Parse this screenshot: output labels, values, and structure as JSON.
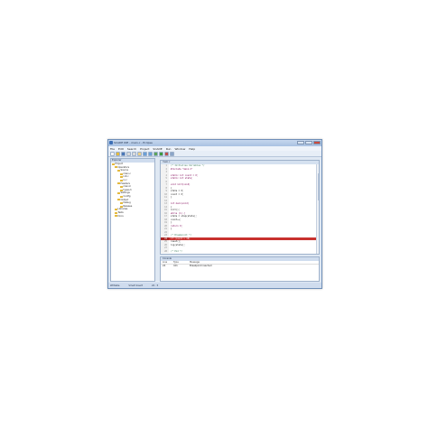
{
  "window": {
    "title": "SCADE IDE - main.c - Eclipse"
  },
  "menubar": [
    "File",
    "Edit",
    "Search",
    "Project",
    "SCADE",
    "Run",
    "Window",
    "Help"
  ],
  "toolbar": {
    "buttons": [
      {
        "icon": "new-file-icon",
        "color": "#f4f4f4"
      },
      {
        "icon": "open-folder-icon",
        "color": "#e4b93c"
      },
      {
        "icon": "save-icon",
        "color": "#4b78b8"
      },
      {
        "icon": "cut-icon",
        "color": "#d9d9d9"
      },
      {
        "icon": "copy-icon",
        "color": "#d9d9d9"
      },
      {
        "icon": "paste-icon",
        "color": "#e9d08a"
      },
      {
        "icon": "undo-icon",
        "color": "#6aa0d8"
      },
      {
        "icon": "redo-icon",
        "color": "#6aa0d8"
      },
      {
        "icon": "build-icon",
        "color": "#5ea55a"
      },
      {
        "icon": "run-icon",
        "color": "#3f9a3f"
      },
      {
        "icon": "debug-icon",
        "color": "#c0504d"
      },
      {
        "icon": "search-icon",
        "color": "#8ba6c9"
      }
    ]
  },
  "left_pane": {
    "caption": "Explorer",
    "tree": [
      "Project",
      "Operators",
      "Source",
      "main.c",
      "init.c",
      "io.c",
      "Headers",
      "main.h",
      "types.h",
      "Settings",
      "Config",
      "Output",
      "Debug",
      "Release",
      "Libraries",
      "Tests",
      "Docs"
    ]
  },
  "editor": {
    "tab": "main.c",
    "lines": [
      {
        "no": "1",
        "text": "/* Initialise Variables */"
      },
      {
        "no": "2",
        "text": "#include \"main.h\""
      },
      {
        "no": "3",
        "text": ""
      },
      {
        "no": "4",
        "text": "static int count = 0;"
      },
      {
        "no": "5",
        "text": "static int state;"
      },
      {
        "no": "6",
        "text": ""
      },
      {
        "no": "7",
        "text": "void init(void)"
      },
      {
        "no": "8",
        "text": "{"
      },
      {
        "no": "9",
        "text": "  state = 0;"
      },
      {
        "no": "10",
        "text": "  count = 0;"
      },
      {
        "no": "11",
        "text": "}"
      },
      {
        "no": "12",
        "text": ""
      },
      {
        "no": "13",
        "text": "int main(void)"
      },
      {
        "no": "14",
        "text": "{"
      },
      {
        "no": "15",
        "text": "  init();"
      },
      {
        "no": "16",
        "text": "  while (1) {"
      },
      {
        "no": "17",
        "text": "    state = step(state);"
      },
      {
        "no": "18",
        "text": "    count++;"
      },
      {
        "no": "19",
        "text": "  }"
      },
      {
        "no": "20",
        "text": "  return 0;"
      },
      {
        "no": "21",
        "text": "}"
      },
      {
        "no": "22",
        "text": ""
      },
      {
        "no": "23",
        "text": "/* Breakpoint */"
      },
      {
        "no": "24",
        "text": "  if (count > 10)",
        "highlight": true
      },
      {
        "no": "25",
        "text": "    reset();"
      },
      {
        "no": "26",
        "text": "  log(state);"
      },
      {
        "no": "27",
        "text": ""
      },
      {
        "no": "28",
        "text": "/* End */"
      }
    ]
  },
  "output": {
    "caption": "Console",
    "headers": [
      "Line",
      "Type",
      "Message"
    ],
    "rows": [
      [
        "24",
        "Info",
        "Breakpoint reached"
      ],
      [
        "",
        "",
        ""
      ]
    ]
  },
  "statusbar": [
    "Writable",
    "Smart Insert",
    "24 : 5"
  ]
}
